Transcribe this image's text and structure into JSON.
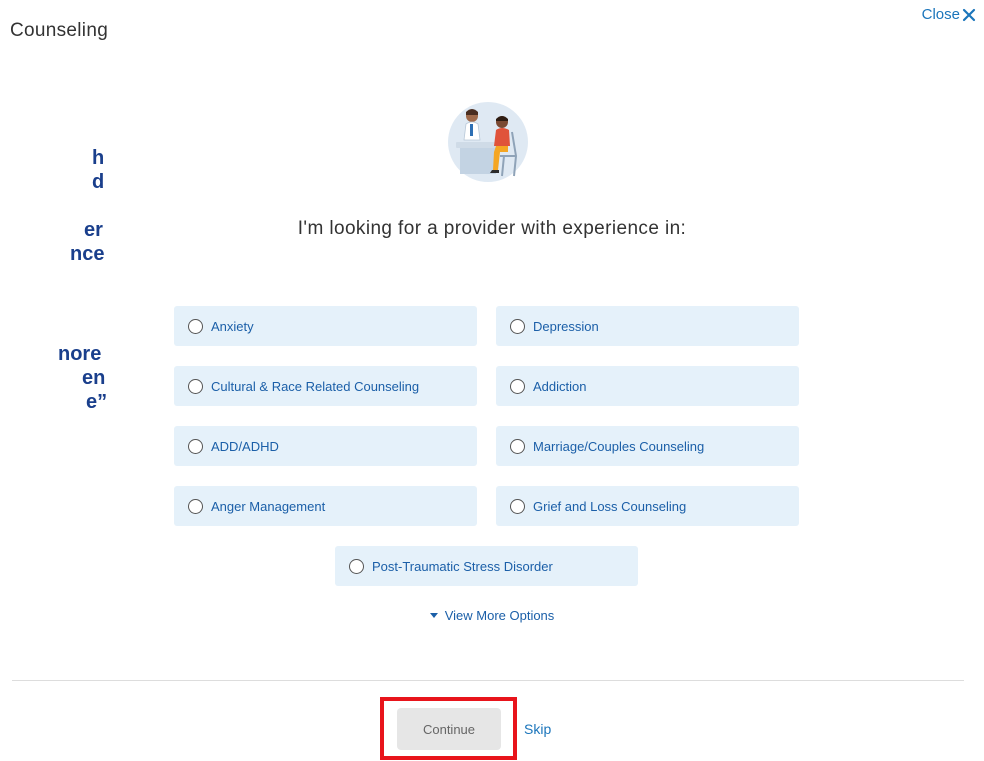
{
  "header": {
    "title": "Counseling",
    "close_label": "Close"
  },
  "side_text_fragments": [
    "h",
    "d",
    "er",
    "nce",
    "nore",
    "en",
    "e”"
  ],
  "question": "I'm looking for a provider with experience in:",
  "options": [
    {
      "label": "Anxiety",
      "selected": false
    },
    {
      "label": "Depression",
      "selected": false
    },
    {
      "label": "Cultural & Race Related Counseling",
      "selected": false
    },
    {
      "label": "Addiction",
      "selected": false
    },
    {
      "label": "ADD/ADHD",
      "selected": false
    },
    {
      "label": "Marriage/Couples Counseling",
      "selected": false
    },
    {
      "label": "Anger Management",
      "selected": false
    },
    {
      "label": "Grief and Loss Counseling",
      "selected": false
    },
    {
      "label": "Post-Traumatic Stress Disorder",
      "selected": false
    }
  ],
  "view_more_label": "View More Options",
  "footer": {
    "continue_label": "Continue",
    "skip_label": "Skip"
  },
  "colors": {
    "accent": "#1b75bb",
    "option_bg": "#e5f1fa",
    "highlight": "#e8141b",
    "side_text": "#1a3f8c"
  }
}
